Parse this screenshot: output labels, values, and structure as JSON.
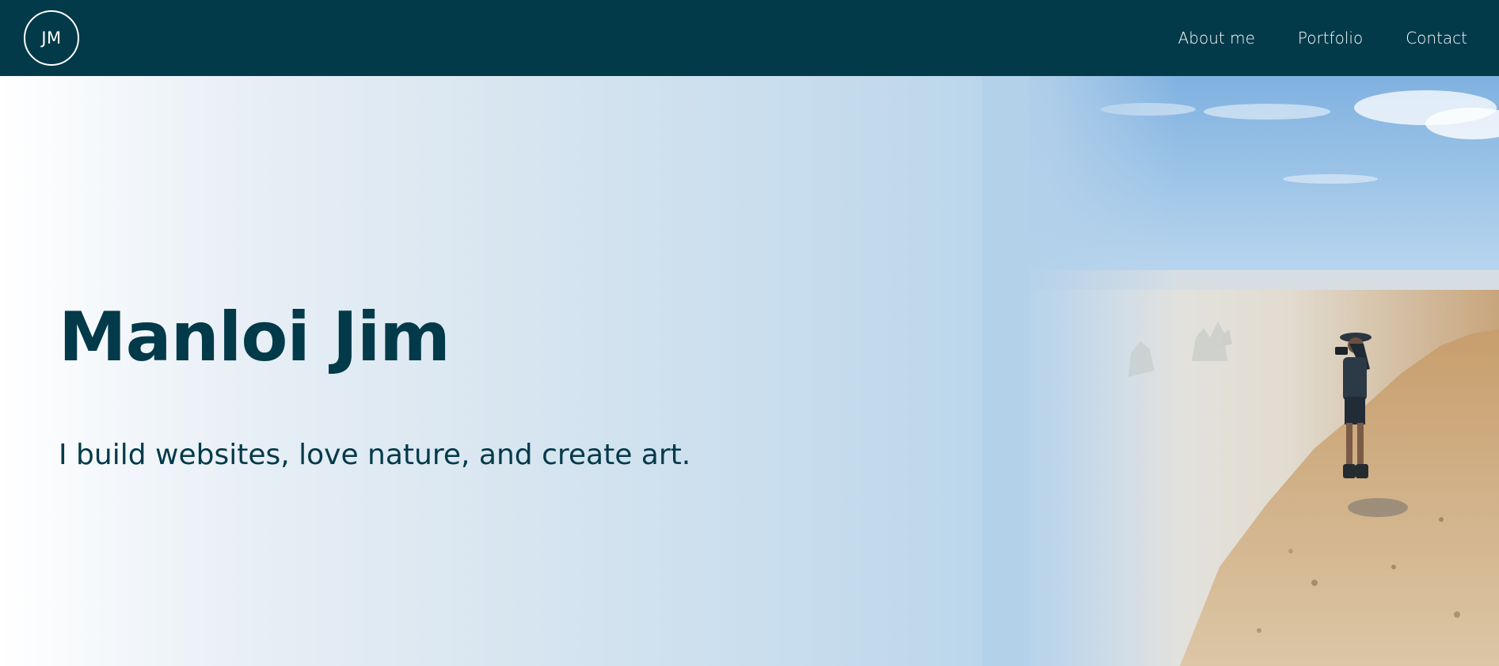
{
  "header": {
    "logo_text": "JM",
    "nav": [
      {
        "label": "About me"
      },
      {
        "label": "Portfolio"
      },
      {
        "label": "Contact"
      }
    ]
  },
  "hero": {
    "title": "Manloi Jim",
    "subtitle": "I build websites, love nature, and create art."
  },
  "colors": {
    "header_bg": "#033a4a",
    "text_primary": "#033a4a",
    "gradient_end": "#a9cce8"
  }
}
